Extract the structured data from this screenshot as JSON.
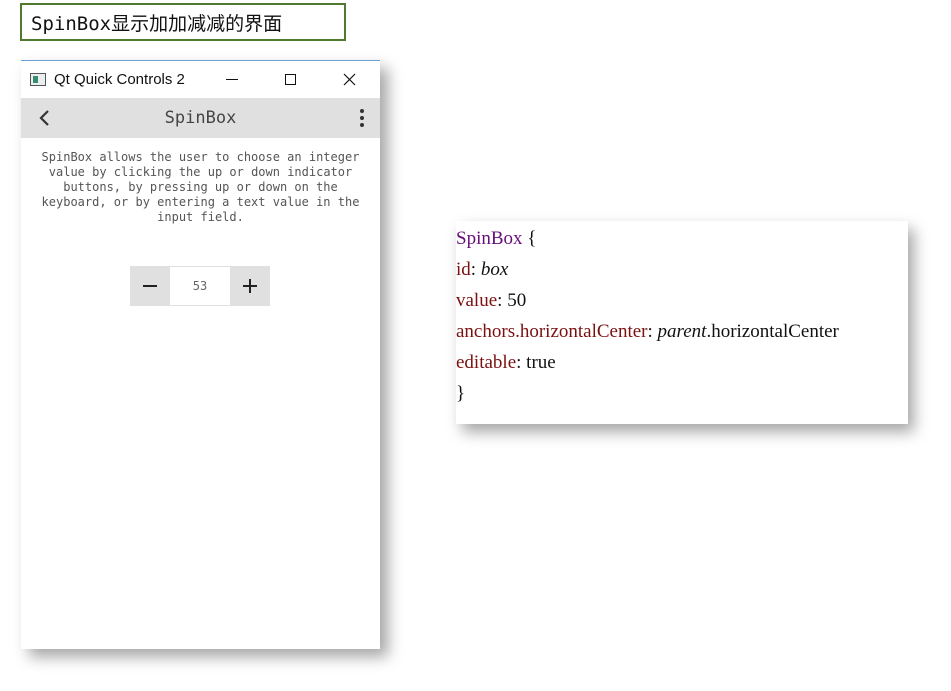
{
  "caption": "SpinBox显示加加减减的界面",
  "window": {
    "title": "Qt Quick Controls 2",
    "toolbar_title": "SpinBox",
    "description": "SpinBox allows the user to choose an integer value by clicking the up or down indicator buttons, by pressing up or down on the keyboard, or by entering a text value in the input field.",
    "spinbox": {
      "minus_label": "−",
      "plus_label": "+",
      "value": "53"
    }
  },
  "code": {
    "line1_type": "SpinBox",
    "line1_brace": " {",
    "line2_prop": "id",
    "line2_colon": ": ",
    "line2_value": "box",
    "line3_prop": "value",
    "line3_colon": ": ",
    "line3_value": "50",
    "line4_prop": "anchors.horizontalCenter",
    "line4_colon": ": ",
    "line4_value_italic": "parent",
    "line4_value_rest": ".horizontalCenter",
    "line5_prop": "editable",
    "line5_colon": ": ",
    "line5_value": "true",
    "line6_brace": "}"
  },
  "colors": {
    "caption_border": "#4f7a2f",
    "toolbar_bg": "#e0e0e0",
    "code_type": "#660e7a",
    "code_prop": "#7a1010"
  }
}
